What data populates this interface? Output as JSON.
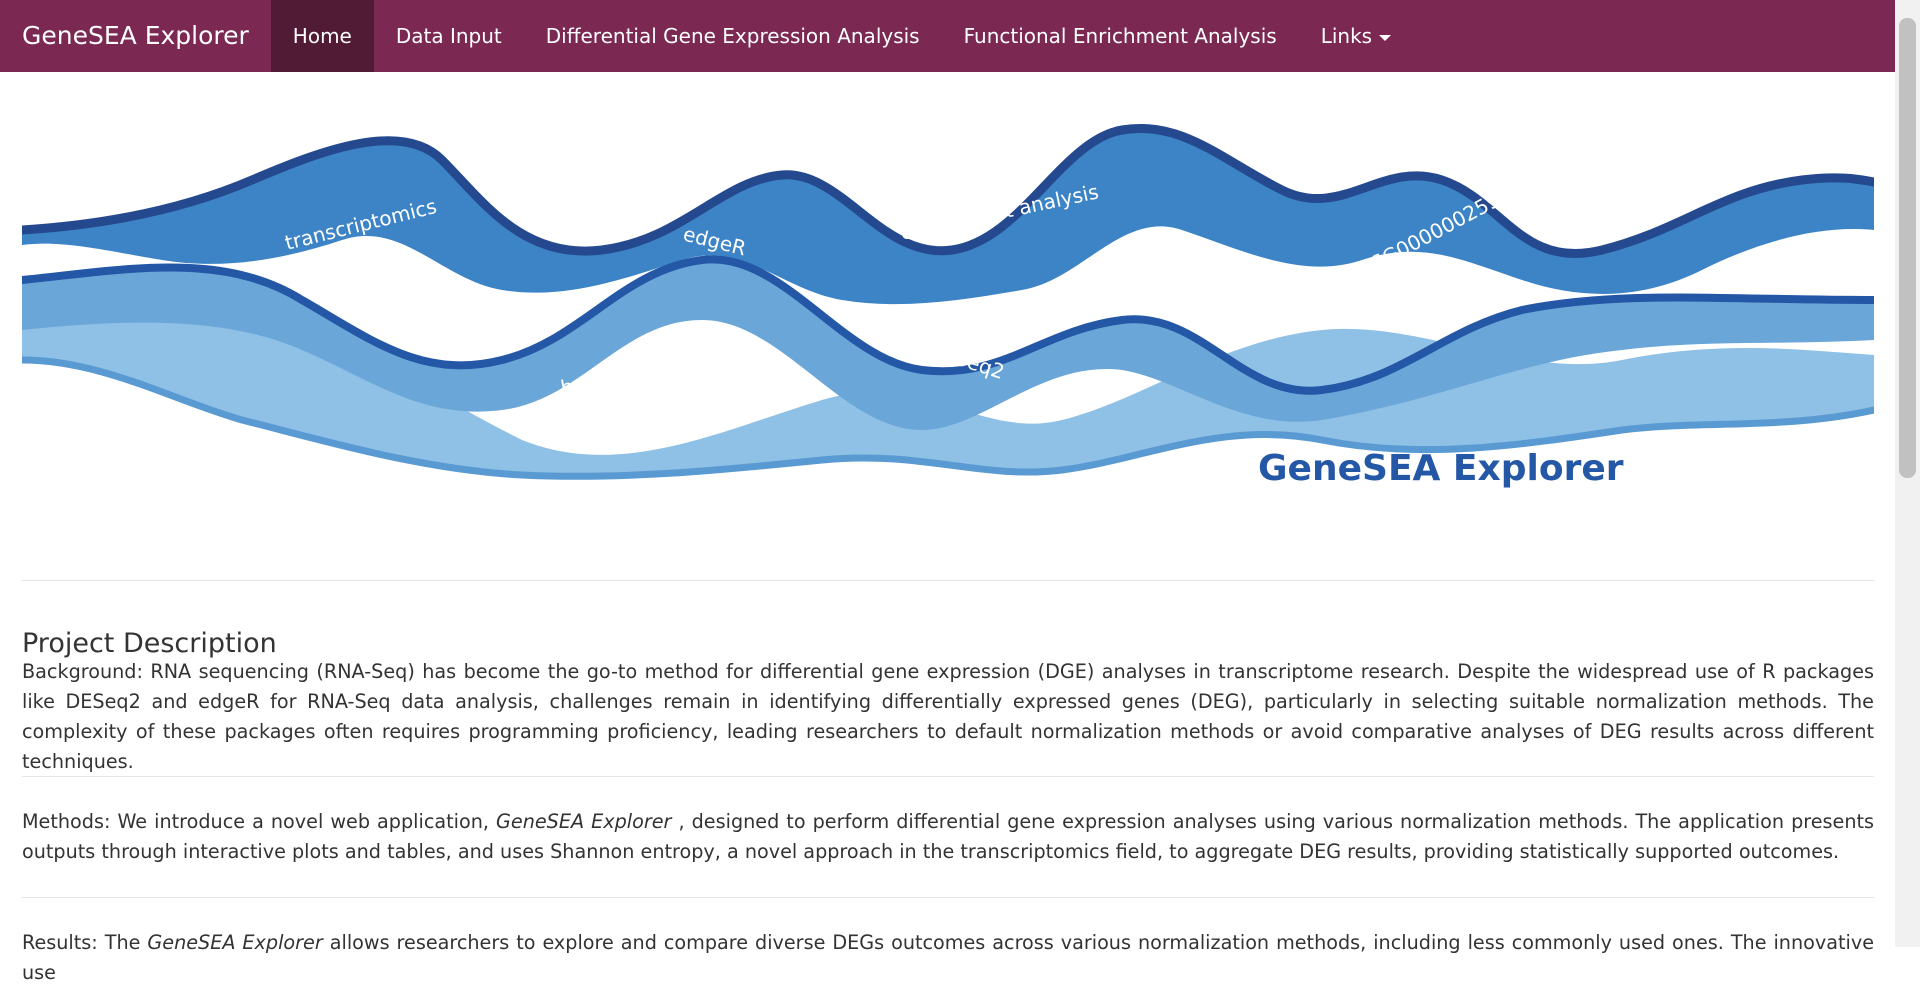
{
  "navbar": {
    "brand": "GeneSEA Explorer",
    "items": [
      {
        "label": "Home"
      },
      {
        "label": "Data Input"
      },
      {
        "label": "Differential Gene Expression Analysis"
      },
      {
        "label": "Functional Enrichment Analysis"
      },
      {
        "label": "Links"
      }
    ]
  },
  "banner": {
    "title": "GeneSEA Explorer",
    "words": [
      "transcriptomics",
      "edgeR",
      "enrichment analysis",
      "ENSMUSG00000025909",
      "bulk RNA sequencing",
      "DESeq2"
    ]
  },
  "main": {
    "heading": "Project Description",
    "background": "Background: RNA sequencing (RNA-Seq) has become the go-to method for differential gene expression (DGE) analyses in transcriptome research. Despite the widespread use of R packages like DESeq2 and edgeR for RNA-Seq data analysis, challenges remain in identifying differentially expressed genes (DEG), particularly in selecting suitable normalization methods. The complexity of these packages often requires programming proficiency, leading researchers to default normalization methods or avoid comparative analyses of DEG results across different techniques.",
    "methods": {
      "prefix": "Methods: We introduce a novel web application, ",
      "app": "GeneSEA Explorer",
      "suffix": " , designed to perform differential gene expression analyses using various normalization methods. The application presents outputs through interactive plots and tables, and uses Shannon entropy, a novel approach in the transcriptomics field, to aggregate DEG results, providing statistically supported outcomes."
    },
    "results": {
      "prefix": "Results: The ",
      "app": "GeneSEA Explorer",
      "suffix": " allows researchers to explore and compare diverse DEGs outcomes across various normalization methods, including less commonly used ones. The innovative use"
    }
  },
  "colors": {
    "navbar": "#7b2853",
    "navbar_active": "#511a35",
    "banner_dark": "#2457a5",
    "banner_light": "#6aa7d8"
  }
}
